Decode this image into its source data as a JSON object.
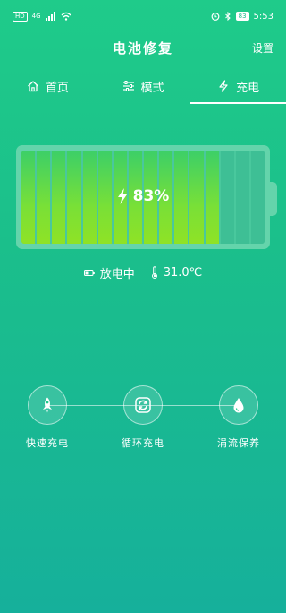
{
  "status_bar": {
    "hd_label": "HD",
    "network_label": "4G",
    "battery_label": "83",
    "time": "5:53"
  },
  "header": {
    "title": "电池修复",
    "settings_label": "设置"
  },
  "tabs": [
    {
      "label": "首页",
      "icon": "home-icon"
    },
    {
      "label": "模式",
      "icon": "sliders-icon"
    },
    {
      "label": "充电",
      "icon": "bolt-icon",
      "active": true
    }
  ],
  "battery": {
    "level": 0.83,
    "label": "83%",
    "cells_total": 16,
    "cells_filled": 13
  },
  "status": {
    "state_label": "放电中",
    "temperature_label": "31.0℃"
  },
  "modes": [
    {
      "label": "快速充电",
      "icon": "rocket-icon"
    },
    {
      "label": "循环充电",
      "icon": "cycle-icon"
    },
    {
      "label": "涓流保养",
      "icon": "drop-icon"
    }
  ],
  "colors": {
    "accent": "#1fcb8a",
    "battery_fill": "#8fe226"
  }
}
